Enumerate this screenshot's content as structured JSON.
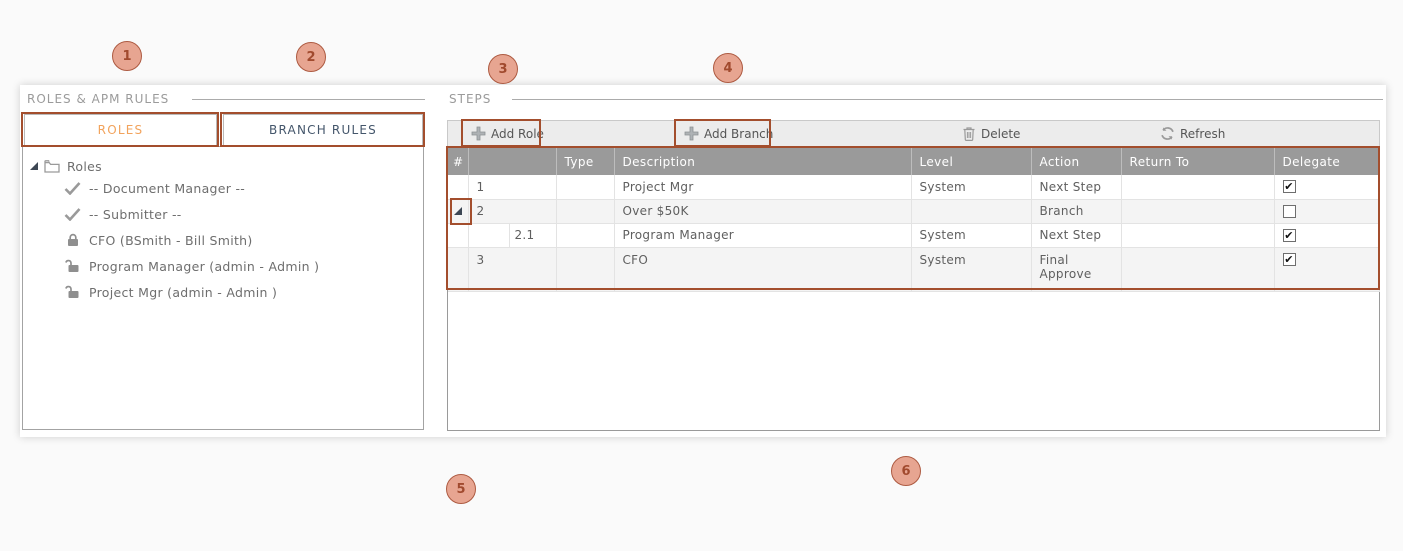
{
  "colors": {
    "annotation_border": "#a34e2d",
    "annotation_fill": "#e7a591",
    "tab_active_text": "#f2a35c",
    "tab_inactive_text": "#44566b",
    "table_header_bg": "#9a9a9a"
  },
  "annotations": {
    "badges": [
      {
        "label": "1"
      },
      {
        "label": "2"
      },
      {
        "label": "3"
      },
      {
        "label": "4"
      },
      {
        "label": "5"
      },
      {
        "label": "6"
      }
    ]
  },
  "left_panel": {
    "title": "ROLES & APM RULES",
    "tabs": [
      {
        "label": "ROLES",
        "active": true
      },
      {
        "label": "BRANCH RULES",
        "active": false
      }
    ],
    "tree": {
      "root_label": "Roles",
      "items": [
        {
          "icon": "check-icon",
          "label": "-- Document Manager --"
        },
        {
          "icon": "check-icon",
          "label": "-- Submitter --"
        },
        {
          "icon": "lock-closed-icon",
          "label": "CFO (BSmith - Bill Smith)"
        },
        {
          "icon": "lock-open-icon",
          "label": "Program Manager (admin - Admin )"
        },
        {
          "icon": "lock-open-icon",
          "label": "Project Mgr (admin - Admin )"
        }
      ]
    }
  },
  "right_panel": {
    "title": "STEPS",
    "toolbar": {
      "add_role_label": "Add Role",
      "add_branch_label": "Add Branch",
      "delete_label": "Delete",
      "refresh_label": "Refresh"
    },
    "table": {
      "columns": [
        "#",
        "Type",
        "Description",
        "Level",
        "Action",
        "Return To",
        "Delegate"
      ],
      "rows": [
        {
          "num": "1",
          "type": "",
          "description": "Project Mgr",
          "level": "System",
          "action": "Next Step",
          "return_to": "",
          "delegate": true,
          "indent": 0,
          "expander": false
        },
        {
          "num": "2",
          "type": "",
          "description": "Over $50K",
          "level": "",
          "action": "Branch",
          "return_to": "",
          "delegate": false,
          "indent": 0,
          "expander": true
        },
        {
          "num": "2.1",
          "type": "",
          "description": "Program Manager",
          "level": "System",
          "action": "Next Step",
          "return_to": "",
          "delegate": true,
          "indent": 1,
          "expander": false
        },
        {
          "num": "3",
          "type": "",
          "description": "CFO",
          "level": "System",
          "action": "Final Approve",
          "return_to": "",
          "delegate": true,
          "indent": 0,
          "expander": false
        }
      ]
    }
  }
}
